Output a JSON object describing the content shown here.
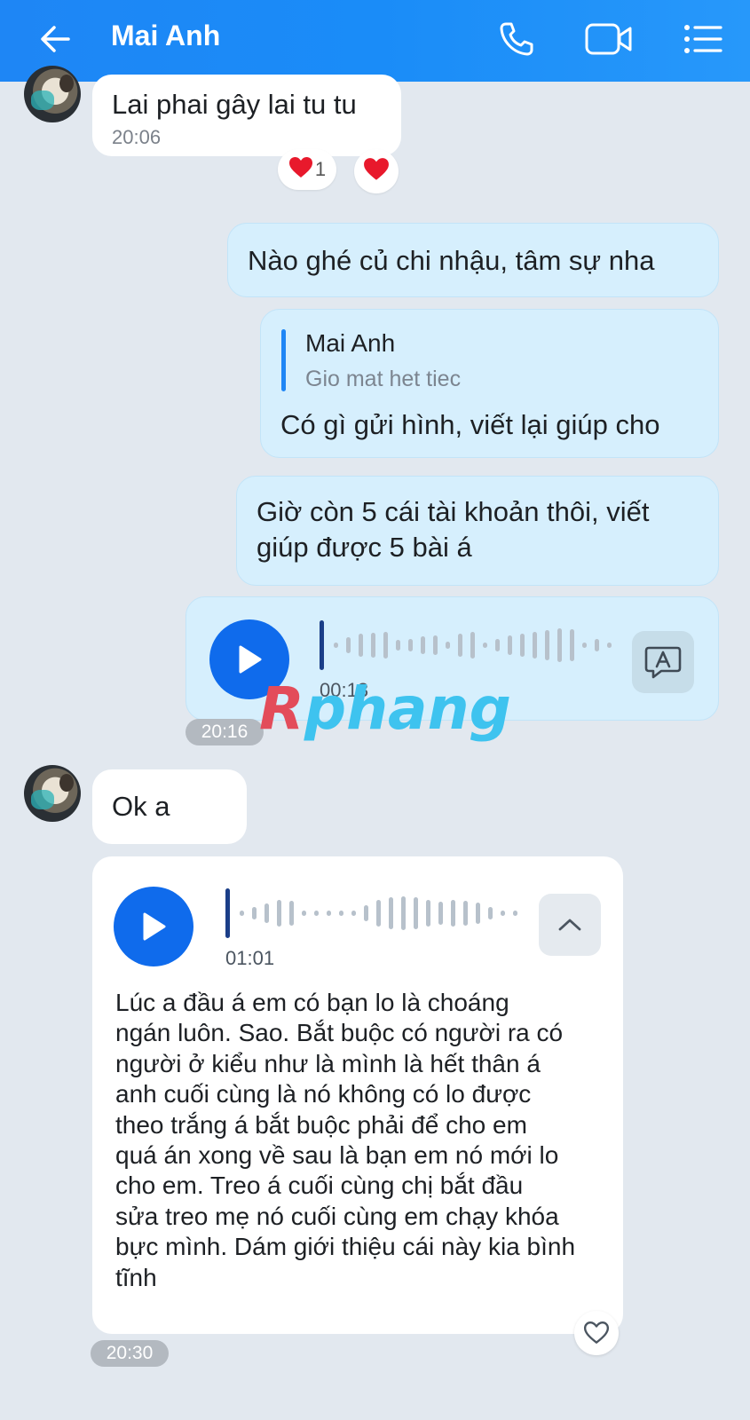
{
  "header": {
    "title": "Mai Anh",
    "icons": [
      "back-arrow-icon",
      "phone-icon",
      "video-call-icon",
      "menu-list-icon"
    ],
    "color": "#1a8cf8"
  },
  "messages": {
    "m1": {
      "text": "Lai phai gây lai tu tu",
      "time": "20:06"
    },
    "reactions": {
      "heart_count": "1"
    },
    "m2": {
      "text": "Nào ghé củ chi nhậu, tâm sự nha"
    },
    "m3": {
      "quote_name": "Mai Anh",
      "quote_text": "Gio mat het tiec",
      "text": "Có gì gửi hình, viết lại giúp cho"
    },
    "m4": {
      "line1": "Giờ còn 5 cái tài khoản thôi, viết",
      "line2": "giúp được 5 bài á"
    },
    "m5": {
      "duration": "00:13"
    },
    "time_pill_1": "20:16",
    "m6": {
      "text": "Ok a"
    },
    "m7": {
      "duration": "01:01",
      "transcript_lines": [
        "Lúc a đầu á em có bạn lo là choáng",
        "ngán luôn. Sao. Bắt buộc có người ra có",
        "người ở kiểu như là mình là hết thân á",
        "anh cuối cùng là nó không có lo được",
        "theo trắng á bắt buộc phải để cho em",
        "quá án xong về sau là bạn em nó mới lo",
        "cho em. Treo á cuối cùng chị bắt đầu",
        "sửa treo mẹ nó cuối cùng em chạy khóa",
        "bực mình. Dám giới thiệu cái này kia bình",
        "tĩnh"
      ]
    },
    "time_pill_2": "20:30"
  },
  "watermark": {
    "r": "R",
    "rest": "phang"
  },
  "colors": {
    "accent": "#0f6bec",
    "out_bubble": "#d6effd",
    "background": "#e2e8ef"
  }
}
